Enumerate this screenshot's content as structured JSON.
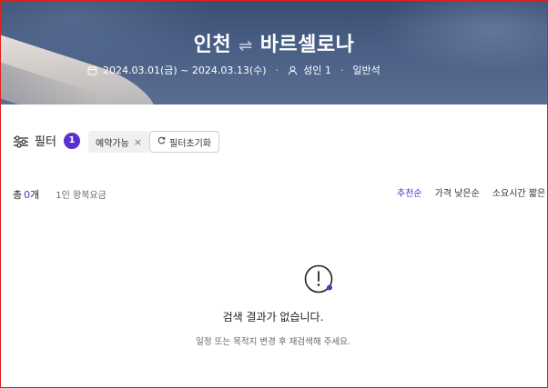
{
  "header": {
    "origin": "인천",
    "route_arrow": "⇌",
    "destination": "바르셀로나",
    "dates": "2024.03.01(금) ~ 2024.03.13(수)",
    "passengers": "성인 1",
    "cabin": "일반석",
    "separator": "·"
  },
  "filter": {
    "label": "필터",
    "count": "1",
    "chip_label": "예약가능",
    "chip_close": "×",
    "reset_label": "필터초기화"
  },
  "results": {
    "total_label": "총 ",
    "total_count": "0",
    "total_unit": "개",
    "fare_type": "1인 왕복요금"
  },
  "sort": {
    "tabs": [
      "추천순",
      "가격 낮은순",
      "소요시간 짧은"
    ],
    "active_index": 0,
    "accent": "#5a2fd0"
  },
  "empty": {
    "title": "검색 결과가 없습니다.",
    "subtitle": "일정 또는 목적지 변경 후 재검색해 주세요."
  },
  "icons": {
    "calendar": "calendar-icon",
    "person": "person-icon",
    "filter": "filter-sliders-icon",
    "refresh": "refresh-icon",
    "alert": "alert-circle-icon"
  }
}
